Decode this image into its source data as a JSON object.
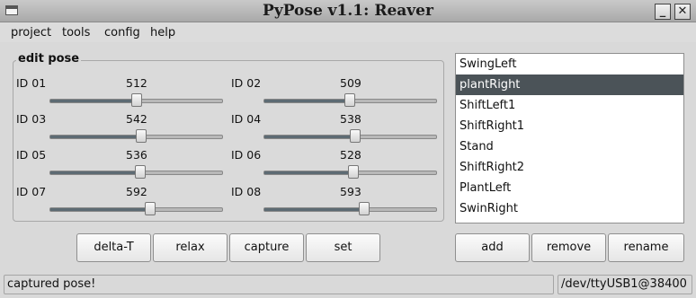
{
  "window": {
    "title": "PyPose v1.1: Reaver",
    "minimize": "_",
    "close": "✕"
  },
  "menu": [
    "project",
    "tools",
    "config",
    "help"
  ],
  "edit_pose": {
    "title": "edit pose",
    "servos": [
      {
        "id": "ID 01",
        "value": "512",
        "level": 0.5
      },
      {
        "id": "ID 02",
        "value": "509",
        "level": 0.497
      },
      {
        "id": "ID 03",
        "value": "542",
        "level": 0.53
      },
      {
        "id": "ID 04",
        "value": "538",
        "level": 0.526
      },
      {
        "id": "ID 05",
        "value": "536",
        "level": 0.524
      },
      {
        "id": "ID 06",
        "value": "528",
        "level": 0.516
      },
      {
        "id": "ID 07",
        "value": "592",
        "level": 0.579
      },
      {
        "id": "ID 08",
        "value": "593",
        "level": 0.58
      }
    ]
  },
  "pose_buttons": {
    "delta_t": "delta-T",
    "relax": "relax",
    "capture": "capture",
    "set": "set"
  },
  "poses": {
    "items": [
      "SwingLeft",
      "plantRight",
      "ShiftLeft1",
      "ShiftRight1",
      "Stand",
      "ShiftRight2",
      "PlantLeft",
      "SwinRight"
    ],
    "selected": "plantRight"
  },
  "list_buttons": {
    "add": "add",
    "remove": "remove",
    "rename": "rename"
  },
  "status": {
    "message": "captured pose!",
    "port": "/dev/ttyUSB1@38400"
  },
  "colors": {
    "selection": "#4b5358",
    "slider_fill": "#5d6b73"
  }
}
